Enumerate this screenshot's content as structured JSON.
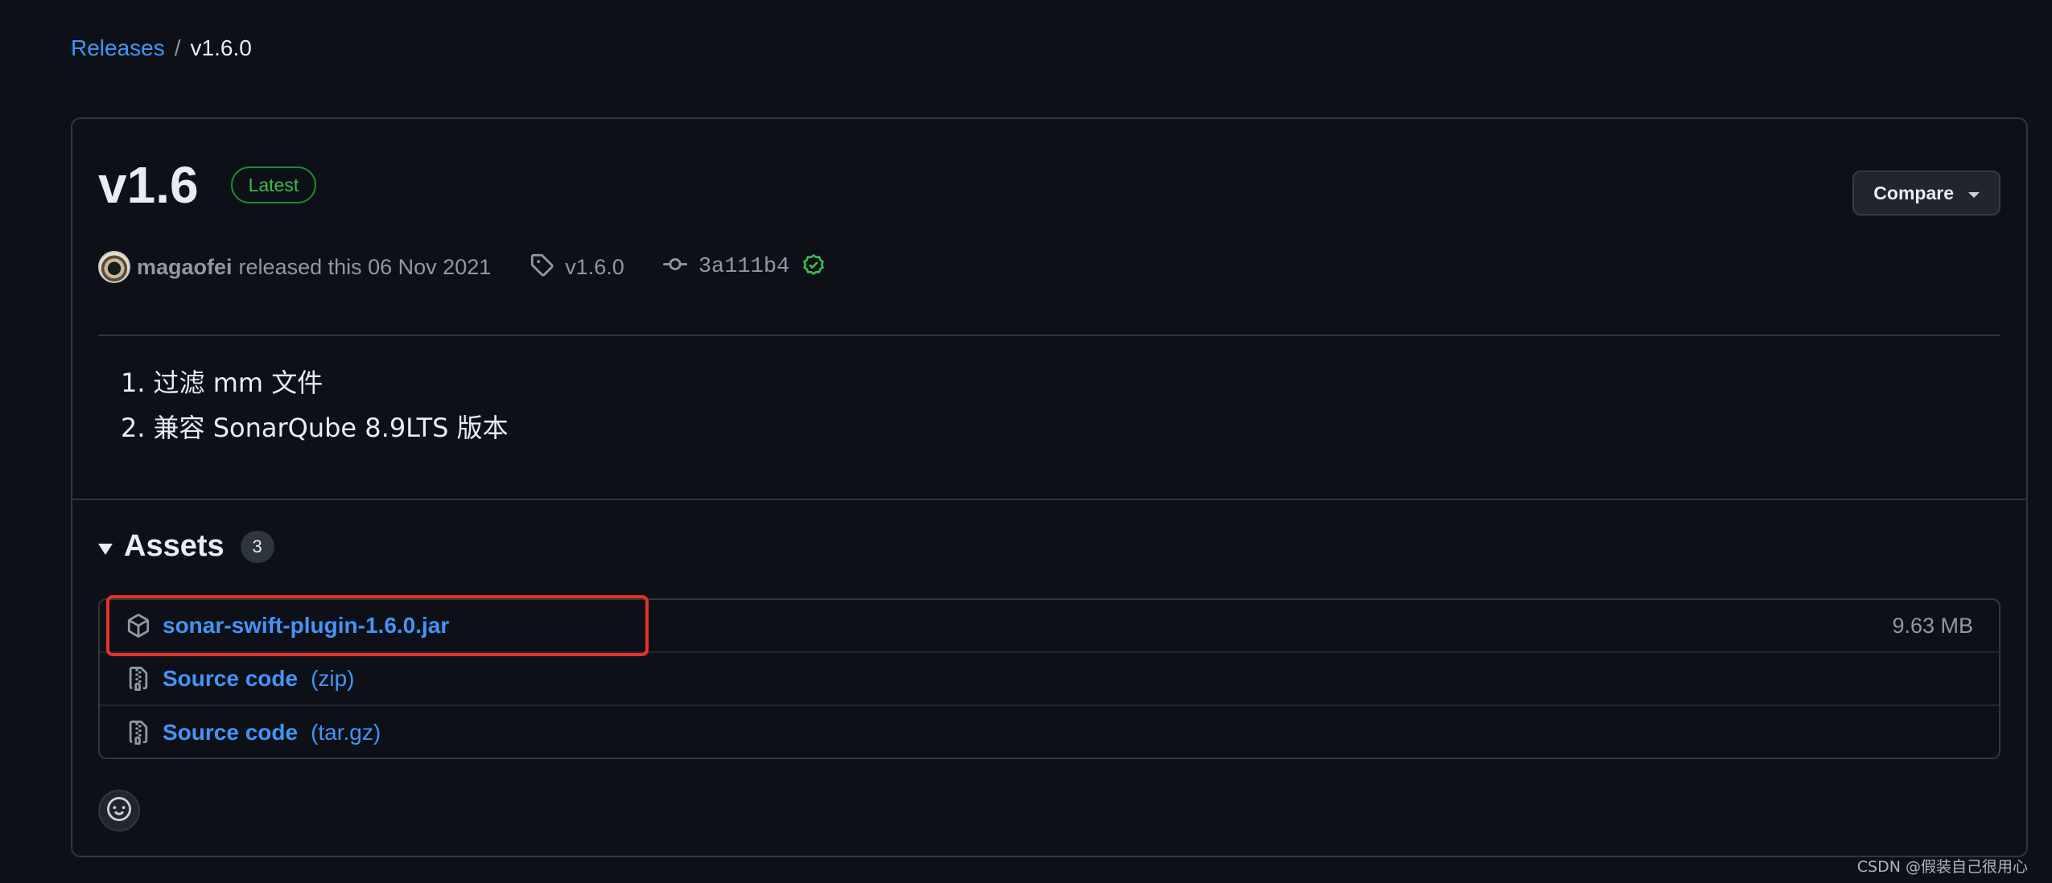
{
  "breadcrumb": {
    "parent": "Releases",
    "separator": "/",
    "current": "v1.6.0"
  },
  "release": {
    "title": "v1.6",
    "latest_badge": "Latest",
    "compare_label": "Compare",
    "author": "magaofei",
    "released_text": "released this 06 Nov 2021",
    "tag": "v1.6.0",
    "commit": "3a111b4",
    "notes": [
      {
        "num": "1.",
        "text": "过滤 mm 文件"
      },
      {
        "num": "2.",
        "text": "兼容 SonarQube 8.9LTS 版本"
      }
    ]
  },
  "assets": {
    "title": "Assets",
    "count": "3",
    "items": [
      {
        "name": "sonar-swift-plugin-1.6.0.jar",
        "suffix": "",
        "size": "9.63 MB",
        "icon": "package-icon"
      },
      {
        "name": "Source code",
        "suffix": "(zip)",
        "size": "",
        "icon": "file-zip-icon"
      },
      {
        "name": "Source code",
        "suffix": "(tar.gz)",
        "size": "",
        "icon": "file-zip-icon"
      }
    ]
  },
  "watermark": "CSDN @假装自己很用心",
  "colors": {
    "background": "#0d1117",
    "link": "#4493f8",
    "latest_green": "#3fb950",
    "highlight_red": "#e5312a"
  }
}
